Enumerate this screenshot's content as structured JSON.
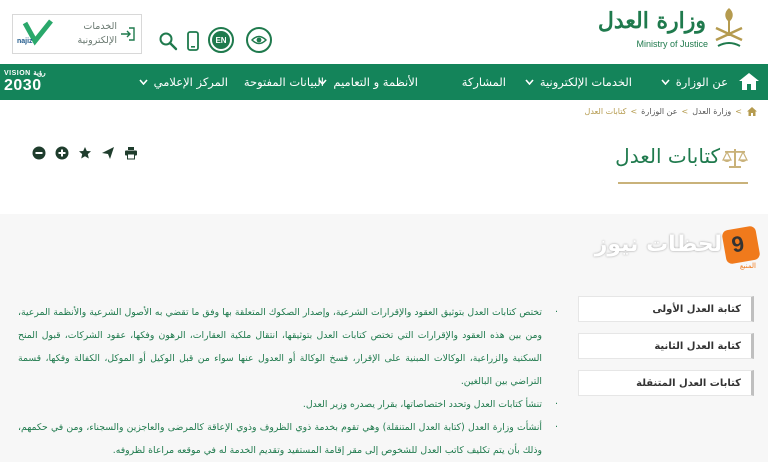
{
  "header": {
    "brand_ar": "وزارة العدل",
    "brand_en": "Ministry of Justice",
    "tools": {
      "lang_label": "EN",
      "icons": [
        "eye-icon",
        "language-icon",
        "mobile-icon",
        "search-icon"
      ]
    },
    "eservices": {
      "line1": "الخدمات",
      "line2": "الإلكترونية",
      "najiz_label": "najiz"
    }
  },
  "nav": {
    "items": [
      {
        "label": "عن الوزارة",
        "has_dropdown": true
      },
      {
        "label": "الخدمات الإلكترونية",
        "has_dropdown": true
      },
      {
        "label": "المشاركة",
        "has_dropdown": false
      },
      {
        "label": "الأنظمة و التعاميم",
        "has_dropdown": true
      },
      {
        "label": "البيانات المفتوحة",
        "has_dropdown": false
      },
      {
        "label": "المركز الإعلامي",
        "has_dropdown": true
      }
    ],
    "vision": {
      "line1": "VISION رؤية",
      "line2": "2030"
    }
  },
  "breadcrumb": {
    "items": [
      "وزارة العدل",
      "عن الوزارة"
    ],
    "current": "كتابات العدل",
    "separator": ">"
  },
  "page": {
    "title": "كتابات العدل"
  },
  "share": {
    "icons": [
      "print-icon",
      "send-icon",
      "star-icon",
      "plus-icon",
      "minus-icon"
    ]
  },
  "watermark": {
    "text": "لحظات نيوز",
    "badge": "9",
    "sub": "المنبع"
  },
  "sidebar": {
    "items": [
      {
        "label": "كتابة العدل الأولى"
      },
      {
        "label": "كتابة العدل الثانية"
      },
      {
        "label": "كتابات العدل المتنقلة"
      }
    ]
  },
  "content": {
    "paragraphs": [
      "تختص كتابات العدل بتوثيق العقود والإقرارات الشرعية، وإصدار الصكوك المتعلقة بها وفق ما تقضي به الأصول الشرعية والأنظمة المرعية، ومن بين هذه العقود والإقرارات التي تختص كتابات العدل بتوثيقها، انتقال ملكية العقارات، الرهون وفكها، عقود الشركات، قبول المنح السكنية والزراعية، الوكالات المبنية على الإقرار، فسخ الوكالة أو العدول عنها سواء من قبل الوكيل أو الموكل، الكفالة وفكها، قسمة التراضي بين البالغين.",
      "تنشأ كتابات العدل وتحدد اختصاصاتها، بقرار يصدره وزير العدل.",
      "أنشأت وزارة العدل (كتابة العدل المتنقلة) وهي تقوم بخدمة ذوي الظروف وذوي الإعاقة كالمرضى والعاجزين والسجناء، ومن في حكمهم، وذلك بأن يتم تكليف كاتب العدل للشخوص إلى مقر إقامة المستفيد وتقديم الخدمة له في موقعه مراعاة لظروفه."
    ]
  },
  "colors": {
    "primary": "#14845a",
    "brand_green": "#1f7a4d",
    "gold": "#b59b4f",
    "content_bg": "#f7f7f7"
  }
}
